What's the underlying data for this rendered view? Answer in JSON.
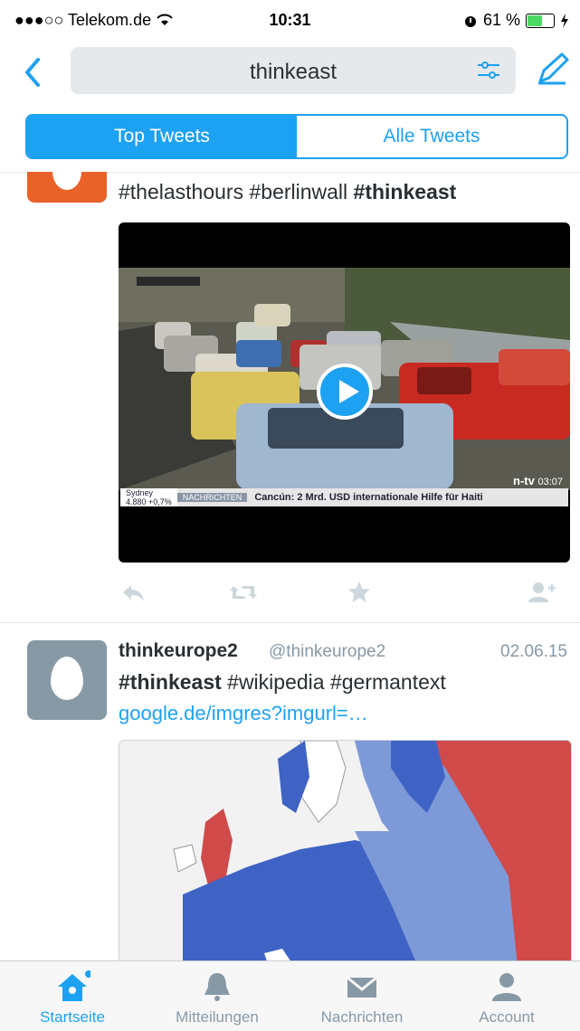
{
  "status_bar": {
    "carrier": "●●●○○ Telekom.de",
    "time": "10:31",
    "battery": "61 %",
    "battery_level": 0.61
  },
  "nav": {
    "search_query": "thinkeast"
  },
  "tabs": {
    "top": "Top Tweets",
    "all": "Alle Tweets"
  },
  "tweet1": {
    "text_parts": [
      "#thelasthours #berlinwall ",
      "#thinkeast"
    ],
    "video": {
      "channel": "n-tv",
      "clock": "03:07",
      "ticker_city": "Sydney",
      "ticker_value": "4.880  +0,7%",
      "ticker_tag": "NACHRICHTEN",
      "ticker_text": "Cancún: 2 Mrd. USD internationale Hilfe für Haiti"
    }
  },
  "tweet2": {
    "name": "thinkeurope2",
    "handle": "@thinkeurope2",
    "date": "02.06.15",
    "text_bold": "#thinkeast",
    "text_rest": " #wikipedia #germantext",
    "link": "google.de/imgres?imgurl=…"
  },
  "tabbar": [
    {
      "label": "Startseite",
      "icon": "home-icon"
    },
    {
      "label": "Mitteilungen",
      "icon": "bell-icon"
    },
    {
      "label": "Nachrichten",
      "icon": "envelope-icon"
    },
    {
      "label": "Account",
      "icon": "person-icon"
    }
  ],
  "colors": {
    "accent": "#1da1f2",
    "text": "#292f33",
    "muted": "#8899a6"
  }
}
